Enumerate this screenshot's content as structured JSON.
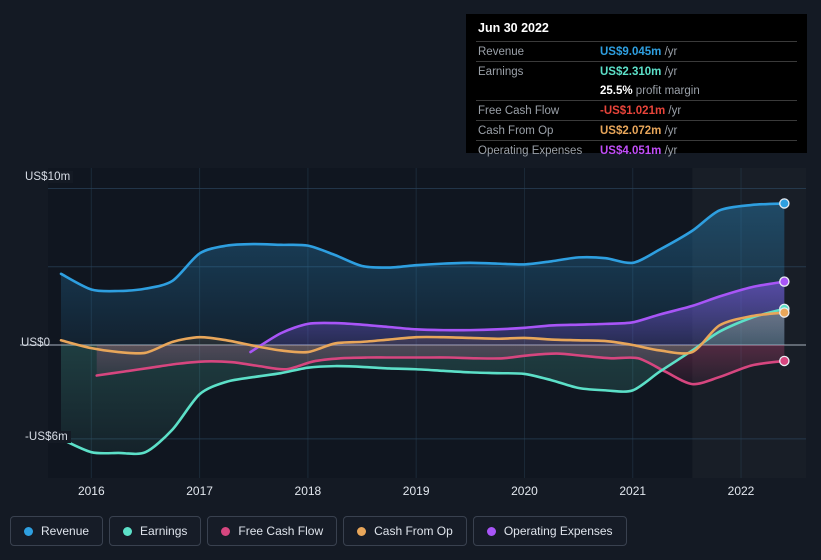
{
  "chart_data": {
    "type": "area",
    "title": "",
    "xlabel": "",
    "ylabel": "",
    "currency_unit": "US$m",
    "ylim": [
      -8.5,
      10.8
    ],
    "xlim": [
      2015.6,
      2022.6
    ],
    "grid": true,
    "legend_position": "bottom",
    "y_ticks": [
      {
        "label": "US$10m",
        "value": 10
      },
      {
        "label": "US$0",
        "value": 0
      },
      {
        "label": "-US$6m",
        "value": -6
      }
    ],
    "x_ticks": [
      "2016",
      "2017",
      "2018",
      "2019",
      "2020",
      "2021",
      "2022"
    ],
    "forecast_start": 2021.55,
    "series": [
      {
        "name": "Revenue",
        "color": "#2e9fe0",
        "x": [
          2015.72,
          2016.0,
          2016.25,
          2016.5,
          2016.75,
          2017.0,
          2017.25,
          2017.5,
          2017.75,
          2018.0,
          2018.25,
          2018.5,
          2018.75,
          2019.0,
          2019.25,
          2019.5,
          2019.75,
          2020.0,
          2020.25,
          2020.5,
          2020.75,
          2021.0,
          2021.25,
          2021.55,
          2021.8,
          2022.1,
          2022.4
        ],
        "values": [
          4.55,
          3.55,
          3.45,
          3.6,
          4.1,
          5.85,
          6.35,
          6.45,
          6.4,
          6.35,
          5.75,
          5.05,
          4.95,
          5.1,
          5.2,
          5.25,
          5.2,
          5.15,
          5.35,
          5.6,
          5.55,
          5.25,
          6.1,
          7.3,
          8.6,
          8.95,
          9.045
        ]
      },
      {
        "name": "Earnings",
        "color": "#5ce0c8",
        "x": [
          2015.72,
          2016.0,
          2016.25,
          2016.5,
          2016.75,
          2017.0,
          2017.25,
          2017.5,
          2017.75,
          2018.0,
          2018.25,
          2018.5,
          2018.75,
          2019.0,
          2019.25,
          2019.5,
          2019.75,
          2020.0,
          2020.25,
          2020.5,
          2020.75,
          2021.0,
          2021.25,
          2021.55,
          2021.8,
          2022.1,
          2022.4
        ],
        "values": [
          -6.0,
          -6.85,
          -6.9,
          -6.85,
          -5.4,
          -3.15,
          -2.35,
          -2.05,
          -1.8,
          -1.45,
          -1.35,
          -1.4,
          -1.5,
          -1.55,
          -1.65,
          -1.75,
          -1.8,
          -1.85,
          -2.25,
          -2.75,
          -2.9,
          -2.9,
          -1.7,
          -0.35,
          0.85,
          1.75,
          2.31
        ]
      },
      {
        "name": "Free Cash Flow",
        "color": "#d6467f",
        "x": [
          2016.05,
          2016.3,
          2016.55,
          2016.8,
          2017.05,
          2017.3,
          2017.55,
          2017.8,
          2018.05,
          2018.3,
          2018.55,
          2018.8,
          2019.05,
          2019.3,
          2019.55,
          2019.8,
          2020.05,
          2020.3,
          2020.55,
          2020.8,
          2021.05,
          2021.3,
          2021.55,
          2021.8,
          2022.1,
          2022.4
        ],
        "values": [
          -1.95,
          -1.7,
          -1.45,
          -1.2,
          -1.05,
          -1.1,
          -1.35,
          -1.55,
          -1.05,
          -0.85,
          -0.8,
          -0.8,
          -0.8,
          -0.8,
          -0.85,
          -0.85,
          -0.65,
          -0.55,
          -0.7,
          -0.85,
          -0.85,
          -1.7,
          -2.5,
          -2.05,
          -1.3,
          -1.021
        ]
      },
      {
        "name": "Cash From Op",
        "color": "#e8a65a",
        "x": [
          2015.72,
          2016.0,
          2016.25,
          2016.5,
          2016.75,
          2017.0,
          2017.25,
          2017.5,
          2017.75,
          2018.0,
          2018.25,
          2018.5,
          2018.75,
          2019.0,
          2019.25,
          2019.5,
          2019.75,
          2020.0,
          2020.25,
          2020.5,
          2020.75,
          2021.0,
          2021.25,
          2021.55,
          2021.8,
          2022.1,
          2022.4
        ],
        "values": [
          0.3,
          -0.2,
          -0.45,
          -0.5,
          0.2,
          0.5,
          0.3,
          -0.05,
          -0.35,
          -0.45,
          0.1,
          0.2,
          0.35,
          0.5,
          0.5,
          0.45,
          0.4,
          0.45,
          0.35,
          0.3,
          0.25,
          0.0,
          -0.35,
          -0.45,
          1.25,
          1.85,
          2.072
        ]
      },
      {
        "name": "Operating Expenses",
        "color": "#a855f7",
        "x": [
          2017.47,
          2017.75,
          2018.0,
          2018.25,
          2018.5,
          2018.75,
          2019.0,
          2019.25,
          2019.5,
          2019.75,
          2020.0,
          2020.25,
          2020.5,
          2020.75,
          2021.0,
          2021.25,
          2021.55,
          2021.8,
          2022.1,
          2022.4
        ],
        "values": [
          -0.45,
          0.75,
          1.35,
          1.4,
          1.3,
          1.15,
          1.0,
          0.95,
          0.95,
          1.0,
          1.1,
          1.25,
          1.3,
          1.35,
          1.45,
          1.95,
          2.5,
          3.1,
          3.7,
          4.051
        ]
      }
    ]
  },
  "tooltip": {
    "date": "Jun 30 2022",
    "rows": [
      {
        "key": "Revenue",
        "value": "US$9.045m",
        "unit": "/yr",
        "color": "#2e9fe0"
      },
      {
        "key": "Earnings",
        "value": "US$2.310m",
        "unit": "/yr",
        "color": "#5ce0c8"
      },
      {
        "key": "Free Cash Flow",
        "value": "-US$1.021m",
        "unit": "/yr",
        "color": "#e8443a"
      },
      {
        "key": "Cash From Op",
        "value": "US$2.072m",
        "unit": "/yr",
        "color": "#e8a65a"
      },
      {
        "key": "Operating Expenses",
        "value": "US$4.051m",
        "unit": "/yr",
        "color": "#c04ef9"
      }
    ],
    "profit_margin_pct": "25.5%",
    "profit_margin_label": "profit margin"
  },
  "legend": {
    "items": [
      {
        "label": "Revenue",
        "color": "#2e9fe0"
      },
      {
        "label": "Earnings",
        "color": "#5ce0c8"
      },
      {
        "label": "Free Cash Flow",
        "color": "#d6467f"
      },
      {
        "label": "Cash From Op",
        "color": "#e8a65a"
      },
      {
        "label": "Operating Expenses",
        "color": "#a855f7"
      }
    ]
  }
}
